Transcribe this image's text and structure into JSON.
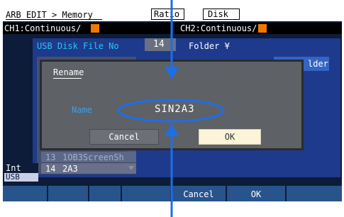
{
  "header": {
    "title": "ARB EDIT > Memory",
    "ratio_tab": "Ratio",
    "disk_tab": "Disk",
    "ch1": "CH1:Continuous/",
    "ch2": "CH2:Continuous/"
  },
  "main": {
    "usb_label": "USB Disk File No",
    "file_no": "14",
    "folder_label": "Folder ¥",
    "side_button": "lder",
    "list_rows": [
      {
        "num": "13",
        "name": "1OB3ScreenSh"
      },
      {
        "num": "14",
        "name": "2A3"
      }
    ],
    "list_header_fragment": "N"
  },
  "dialog": {
    "title": "Rename",
    "name_label": "Name",
    "name_value": "SIN2A3",
    "cancel_label": "Cancel",
    "ok_label": "OK"
  },
  "status": {
    "int_label": "Int",
    "usb_label": "USB"
  },
  "softkeys": [
    "",
    "",
    "",
    "",
    "Cancel",
    "OK",
    ""
  ],
  "colors": {
    "screen_bg": "#0d1c38",
    "panel_bg": "#1e3a8c",
    "accent_orange": "#f07800",
    "label_cyan": "#28c8e8",
    "ok_highlight": "#fcf4d8",
    "annotation_blue": "#1e6ee8"
  }
}
